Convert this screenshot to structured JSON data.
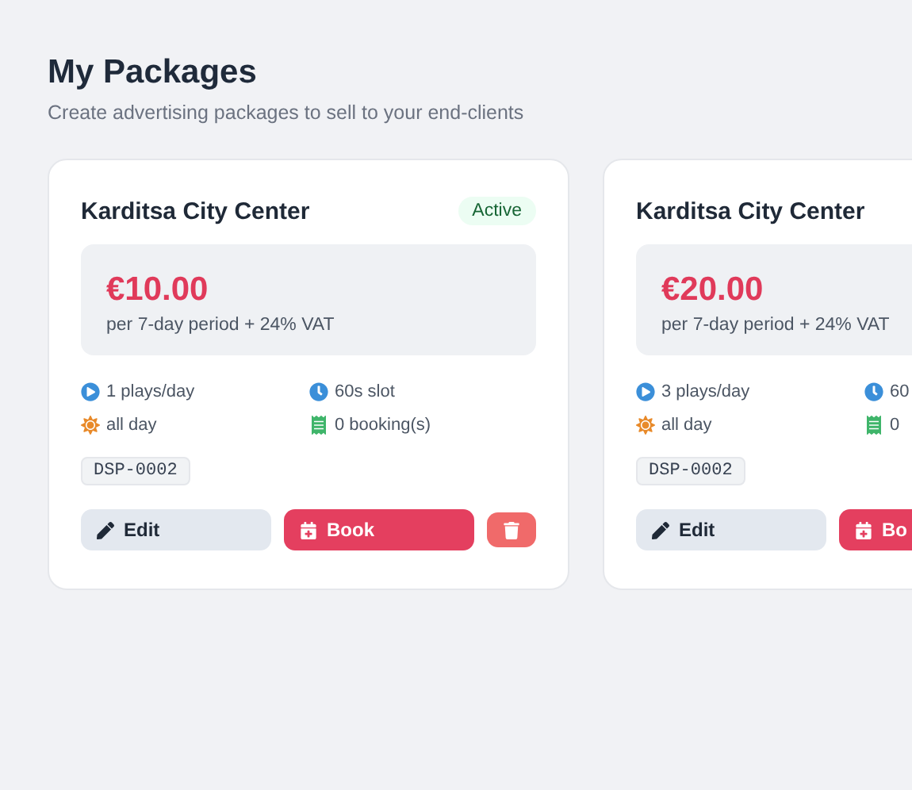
{
  "header": {
    "title": "My Packages",
    "subtitle": "Create advertising packages to sell to your end-clients"
  },
  "packages": [
    {
      "name": "Karditsa City Center",
      "status": "Active",
      "price": "€10.00",
      "period": "per 7-day period + 24% VAT",
      "plays": "1 plays/day",
      "slot": "60s slot",
      "time": "all day",
      "bookings": "0 booking(s)",
      "code": "DSP-0002",
      "edit": "Edit",
      "book": "Book",
      "delete": true
    },
    {
      "name": "Karditsa City Center",
      "price": "€20.00",
      "period": "per 7-day period + 24% VAT",
      "plays": "3 plays/day",
      "slot": "60",
      "time": "all day",
      "bookings": "0",
      "code": "DSP-0002",
      "edit": "Edit",
      "book": "Bo"
    }
  ]
}
